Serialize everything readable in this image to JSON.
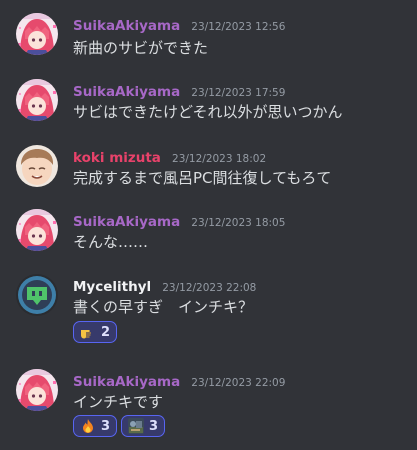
{
  "colors": {
    "background": "#313338",
    "suika": "#a768c7",
    "koki": "#e8426a",
    "mycelithyl": "#f2f3f5",
    "timestamp": "#949ba4",
    "reaction_border": "#5865f2",
    "reaction_bg": "#373a6b"
  },
  "messages": [
    {
      "user": "SuikaAkiyama",
      "time": "23/12/2023 12:56",
      "text": "新曲のサビができた",
      "avatar": "suika-avatar"
    },
    {
      "user": "SuikaAkiyama",
      "time": "23/12/2023 17:59",
      "text": "サビはできたけどそれ以外が思いつかん",
      "avatar": "suika-avatar"
    },
    {
      "user": "koki mizuta",
      "time": "23/12/2023 18:02",
      "text": "完成するまで風呂PC間往復してもろて",
      "avatar": "koki-avatar"
    },
    {
      "user": "SuikaAkiyama",
      "time": "23/12/2023 18:05",
      "text": "そんな……",
      "avatar": "suika-avatar"
    },
    {
      "user": "Mycelithyl",
      "time": "23/12/2023 22:08",
      "text": "書くの早すぎ　インチキ？",
      "avatar": "mycelithyl-avatar",
      "reactions": [
        {
          "emoji": "pointing-hand-emoji",
          "count": "2"
        }
      ]
    },
    {
      "user": "SuikaAkiyama",
      "time": "23/12/2023 22:09",
      "text": "インチキです",
      "avatar": "suika-avatar",
      "reactions": [
        {
          "emoji": "fire-emoji",
          "count": "3"
        },
        {
          "emoji": "custom-image-emoji",
          "count": "3"
        }
      ]
    }
  ]
}
